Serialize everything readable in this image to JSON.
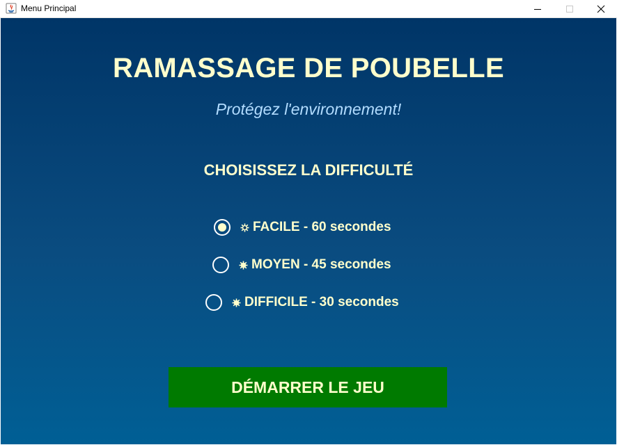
{
  "window": {
    "title": "Menu Principal",
    "icons": {
      "app": "java-app-icon",
      "minimize": "minimize-icon",
      "maximize": "maximize-icon",
      "close": "close-icon"
    }
  },
  "colors": {
    "background_top": "#003567",
    "background_bottom": "#005f95",
    "title_text": "#ffffcc",
    "subtitle_text": "#b2dcff",
    "button_background": "#007a00"
  },
  "main": {
    "title": "RAMASSAGE DE POUBELLE",
    "subtitle": "Protégez l'environnement!",
    "difficulty_heading": "CHOISISSEZ LA DIFFICULTÉ",
    "options": [
      {
        "label": "FACILE - 60 secondes",
        "selected": true,
        "icon": "sun-icon"
      },
      {
        "label": "MOYEN - 45 secondes",
        "selected": false,
        "icon": "sun-icon"
      },
      {
        "label": "DIFFICILE - 30 secondes",
        "selected": false,
        "icon": "sun-icon"
      }
    ],
    "start_button": "DÉMARRER LE JEU"
  }
}
